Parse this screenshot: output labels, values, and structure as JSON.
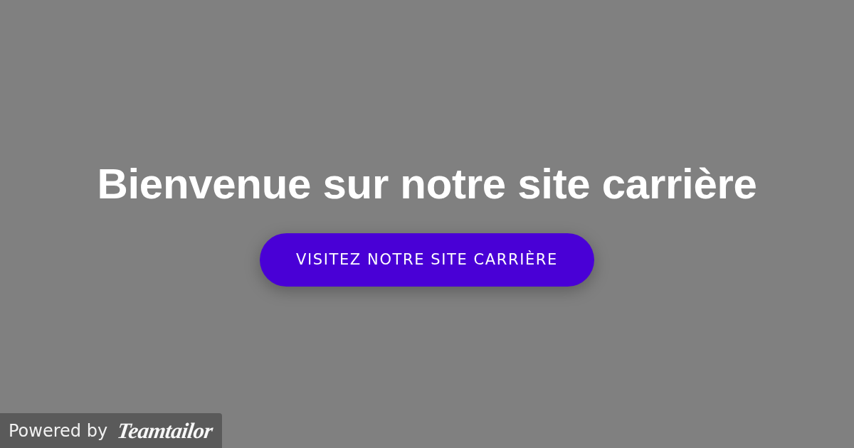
{
  "heading": "Bienvenue sur notre site carrière",
  "button": {
    "label": "VISITEZ NOTRE SITE CARRIÈRE"
  },
  "badge": {
    "text": "Powered by",
    "logo": "Teamtailor"
  }
}
